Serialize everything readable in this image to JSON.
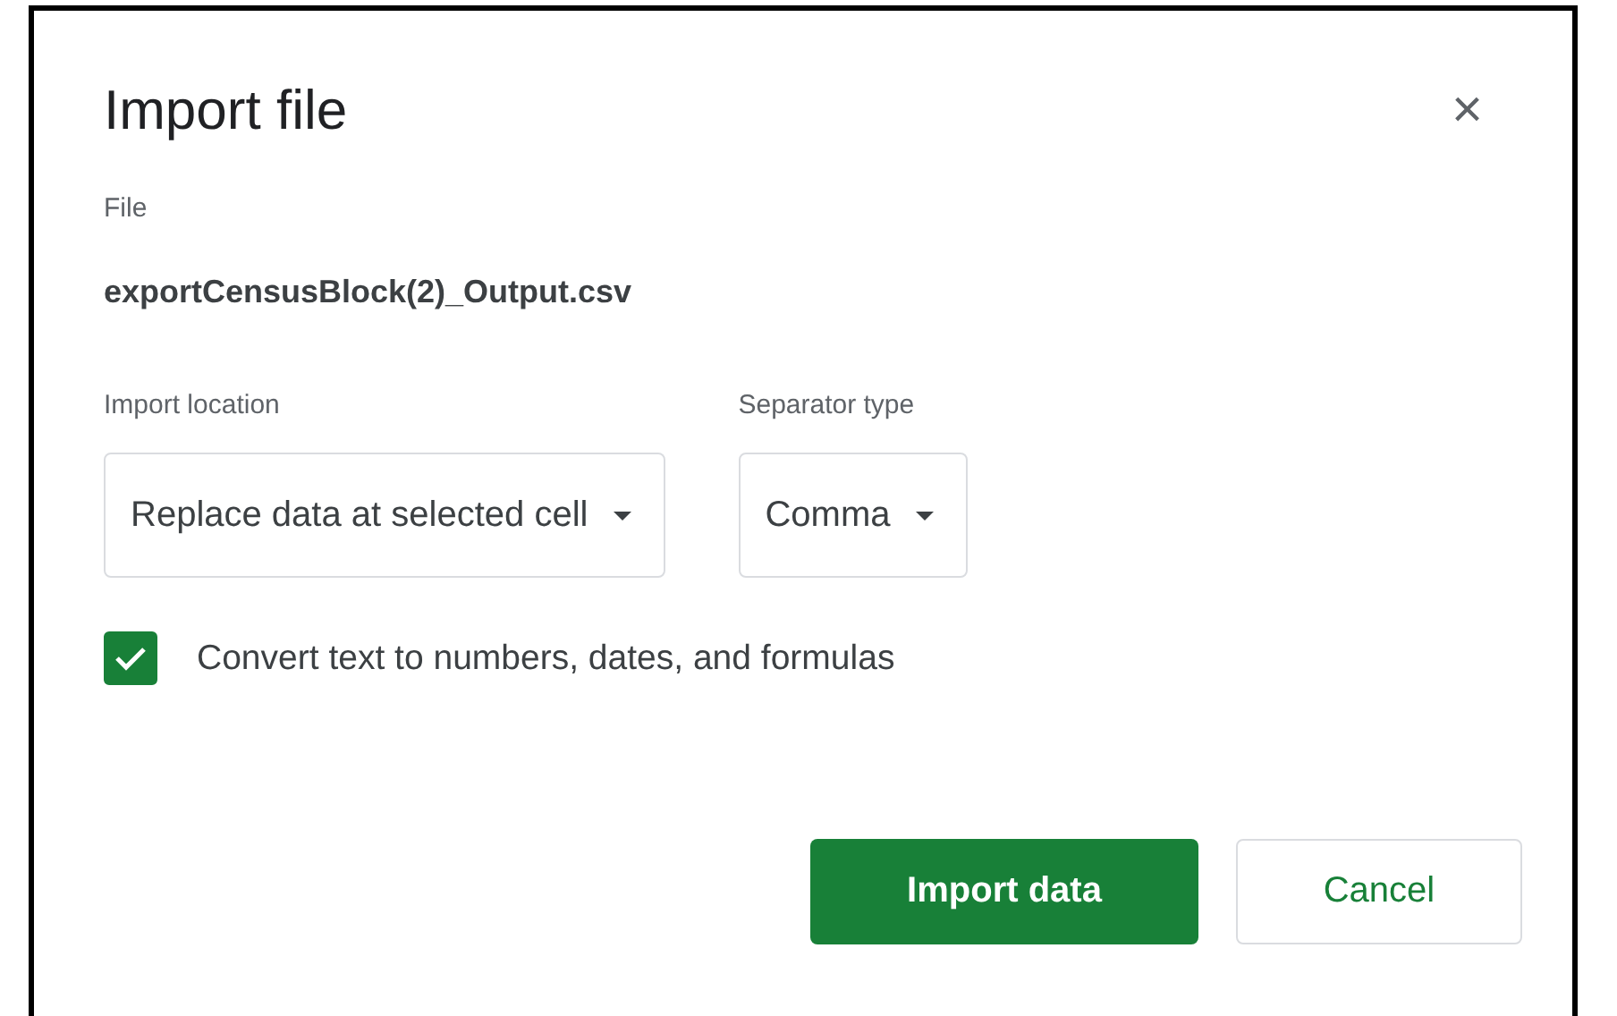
{
  "dialog": {
    "title": "Import file",
    "close": "×"
  },
  "file": {
    "label": "File",
    "name": "exportCensusBlock(2)_Output.csv"
  },
  "fields": [
    {
      "label": "Import location",
      "value": "Replace data at selected cell"
    },
    {
      "label": "Separator type",
      "value": "Comma"
    }
  ],
  "convert": {
    "label": "Convert text to numbers, dates, and formulas",
    "checked": true
  },
  "buttons": [
    {
      "label": "Import data",
      "kind": "primary"
    },
    {
      "label": "Cancel",
      "kind": "secondary"
    }
  ]
}
